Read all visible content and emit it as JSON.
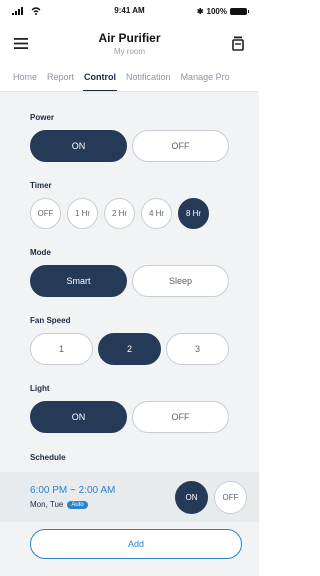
{
  "status_bar": {
    "time": "9:41 AM",
    "battery": "100%"
  },
  "header": {
    "title": "Air Purifier",
    "subtitle": "My room"
  },
  "tabs": [
    {
      "label": "Home"
    },
    {
      "label": "Report"
    },
    {
      "label": "Control",
      "active": true
    },
    {
      "label": "Notification"
    },
    {
      "label": "Manage Pro"
    }
  ],
  "power": {
    "label": "Power",
    "options": [
      "ON",
      "OFF"
    ],
    "selected": "ON"
  },
  "timer": {
    "label": "Timer",
    "options": [
      "OFF",
      "1 Hr",
      "2 Hr",
      "4 Hr",
      "8 Hr"
    ],
    "selected": "8 Hr"
  },
  "mode": {
    "label": "Mode",
    "options": [
      "Smart",
      "Sleep"
    ],
    "selected": "Smart"
  },
  "fan_speed": {
    "label": "Fan Speed",
    "options": [
      "1",
      "2",
      "3"
    ],
    "selected": "2"
  },
  "light": {
    "label": "Light",
    "options": [
      "ON",
      "OFF"
    ],
    "selected": "ON"
  },
  "schedule": {
    "label": "Schedule",
    "time_range": "6:00 PM ~ 2:00 AM",
    "days": "Mon, Tue",
    "badge": "Auto",
    "toggle": [
      "ON",
      "OFF"
    ],
    "selected": "ON"
  },
  "add_button": "Add",
  "colors": {
    "primary": "#253a57",
    "accent": "#2c82c9",
    "background": "#f2f3f5"
  }
}
